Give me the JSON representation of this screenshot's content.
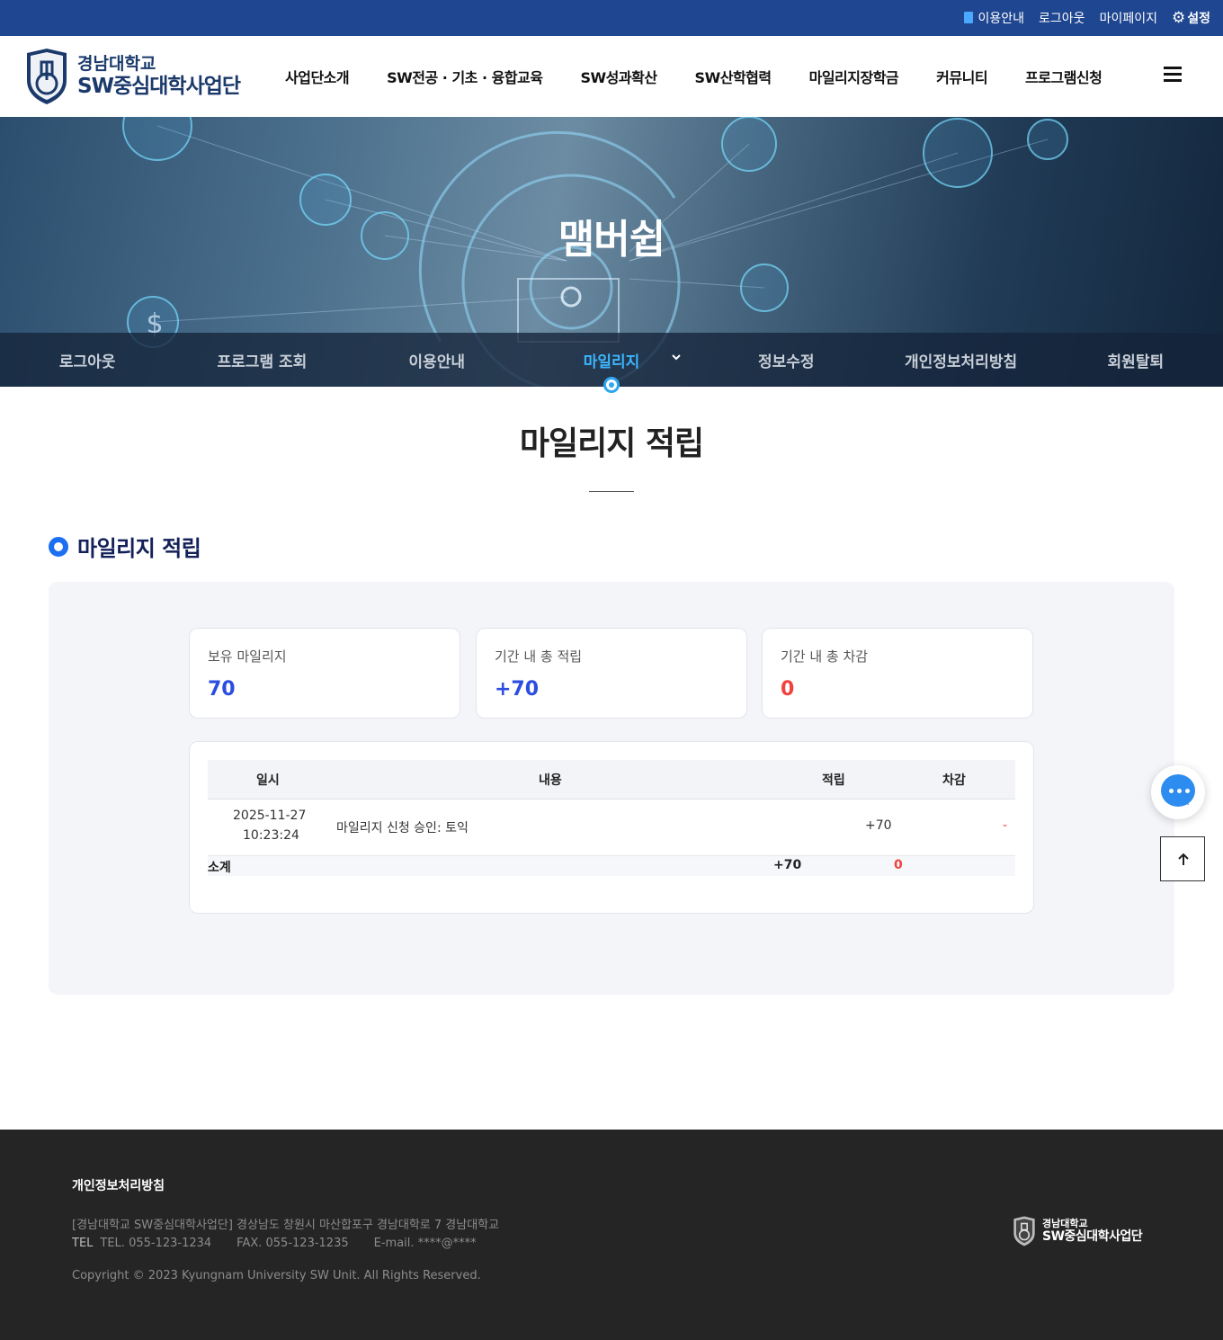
{
  "topbar": {
    "links": [
      "이용안내",
      "로그아웃",
      "마이페이지"
    ],
    "settings_label": "설정",
    "colors": {
      "background": "#1f4690",
      "accent": "#4aa9ff"
    }
  },
  "header": {
    "logo_line1": "경남대학교",
    "logo_line2": "SW중심대학사업단",
    "menu": [
      "사업단소개",
      "SW전공 · 기초 · 융합교육",
      "SW성과확산",
      "SW산학협력",
      "마일리지장학금",
      "커뮤니티",
      "프로그램신청"
    ]
  },
  "banner": {
    "title": "맴버쉽",
    "subnav": [
      "로그아웃",
      "프로그램 조회",
      "이용안내",
      "마일리지",
      "정보수정",
      "개인정보처리방침",
      "회원탈퇴"
    ],
    "active_index": 3
  },
  "page": {
    "title": "마일리지 적립",
    "section_title": "마일리지 적립"
  },
  "summary": [
    {
      "label": "보유 마일리지",
      "value": "70",
      "color": "#2b4de0"
    },
    {
      "label": "기간 내 총 적립",
      "value": "+70",
      "color": "#2b4de0"
    },
    {
      "label": "기간 내 총 차감",
      "value": "0",
      "color": "#f0413e"
    }
  ],
  "table": {
    "headers": [
      "일시",
      "내용",
      "적립",
      "차감"
    ],
    "rows": [
      {
        "date": "2025-11-27",
        "time": "10:23:24",
        "content": "마일리지 신청 승인: 토익",
        "earn": "+70",
        "deduct": "-"
      }
    ],
    "subtotal": {
      "label": "소계",
      "earn": "+70",
      "deduct": "0"
    }
  },
  "footer": {
    "policy": "개인정보처리방침",
    "address": "[경남대학교 SW중심대학사업단]   경상남도 창원시 마산합포구 경남대학로 7 경남대학교",
    "tel_label": "TEL",
    "tel": "TEL. 055-123-1234",
    "fax": "FAX. 055-123-1235",
    "email": "E-mail. ****@****",
    "copyright": "Copyright © 2023 Kyungnam University SW Unit. All Rights Reserved.",
    "logo_line1": "경남대학교",
    "logo_line2": "SW중심대학사업단"
  }
}
